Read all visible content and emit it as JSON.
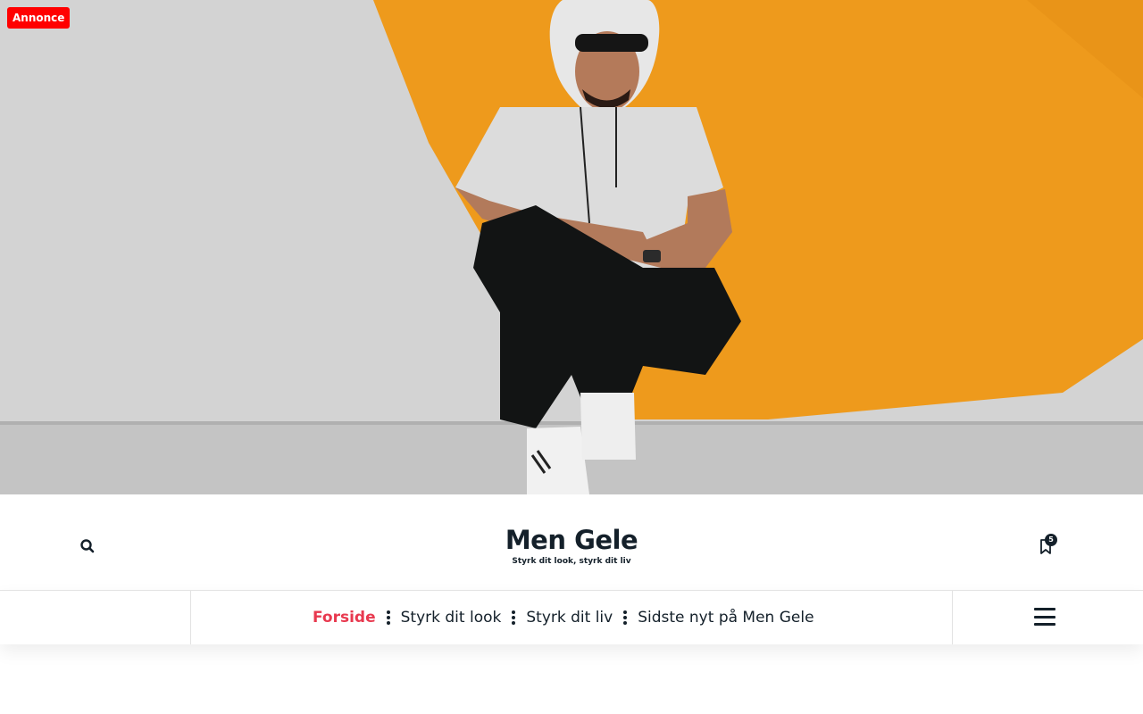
{
  "ad_badge": "Annonce",
  "header": {
    "site_title": "Men Gele",
    "tagline": "Styrk dit look, styrk dit liv",
    "bookmark_count": "5",
    "search_icon": "search-icon",
    "bookmark_icon": "bookmark-icon"
  },
  "nav": {
    "items": [
      {
        "label": "Forside",
        "active": true
      },
      {
        "label": "Styrk dit look",
        "active": false
      },
      {
        "label": "Styrk dit liv",
        "active": false
      },
      {
        "label": "Sidste nyt på Men Gele",
        "active": false
      }
    ],
    "menu_icon": "hamburger-menu-icon"
  },
  "colors": {
    "accent": "#e8394f",
    "text": "#14202a",
    "ad_red": "#ff0000",
    "hero_orange": "#ee9a1c"
  }
}
